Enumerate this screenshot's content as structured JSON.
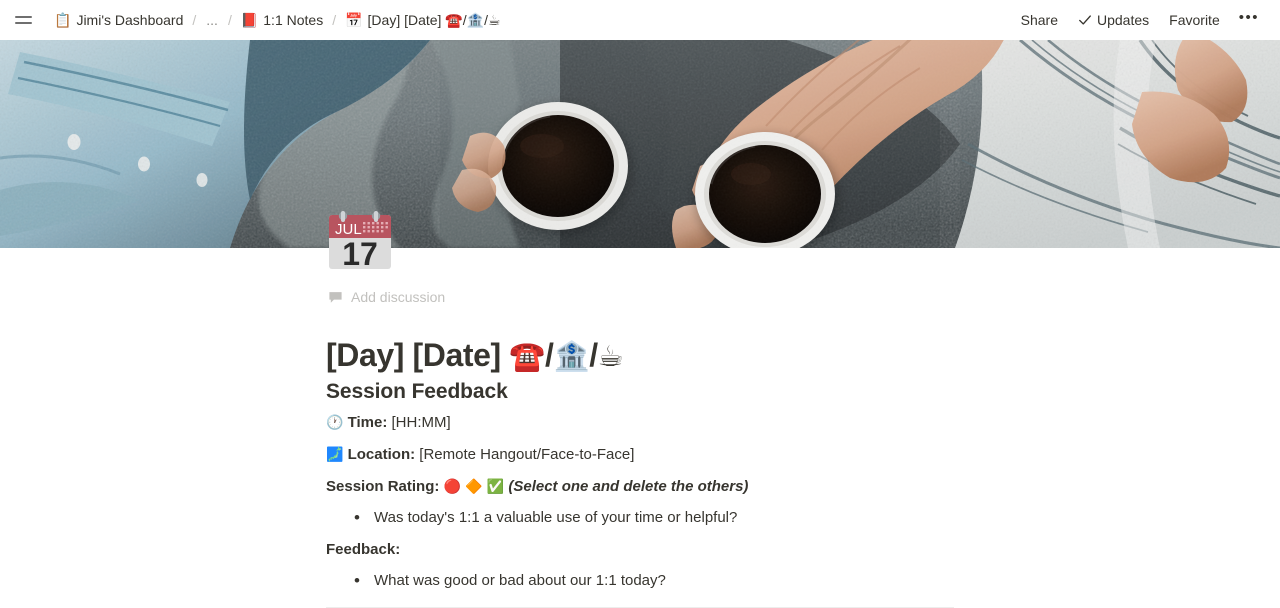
{
  "topbar": {
    "menu_icon": "hamburger-menu-icon",
    "breadcrumbs": [
      {
        "icon": "clipboard-emoji",
        "glyph": "📋",
        "label": "Jimi's Dashboard"
      },
      {
        "icon": "ellipsis",
        "glyph": "",
        "label": "..."
      },
      {
        "icon": "closed-book-emoji",
        "glyph": "📕",
        "label": "1:1 Notes"
      },
      {
        "icon": "calendar-emoji",
        "glyph": "📅",
        "label": "[Day] [Date] ☎️/🏦/☕"
      }
    ],
    "separator": "/",
    "actions": {
      "share": "Share",
      "updates": "Updates",
      "updates_icon": "checkmark-icon",
      "favorite": "Favorite",
      "more": "•••",
      "more_icon": "more-options-icon"
    }
  },
  "cover": {
    "alt": "Two people holding paper cups of black coffee, overhead view on a grey textured surface",
    "icon_emoji": "calendar-emoji",
    "icon_month": "JUL",
    "icon_day": "17"
  },
  "discussion": {
    "icon": "comment-icon",
    "label": "Add discussion"
  },
  "page": {
    "title_text": "[Day] [Date] ",
    "title_emoji_1": "☎️",
    "title_emoji_2": "🏦",
    "title_emoji_3": "☕",
    "title_slash": "/"
  },
  "body": {
    "section_heading": "Session Feedback",
    "time": {
      "icon": "clock-emoji",
      "glyph": "🕐",
      "label": "Time:",
      "value": "[HH:MM]"
    },
    "location": {
      "icon": "map-emoji",
      "glyph": "🗾",
      "label": "Location:",
      "value": "[Remote Hangout/Face-to-Face]"
    },
    "rating": {
      "label": "Session Rating:",
      "options": [
        "🔴",
        "🔶",
        "✅"
      ],
      "hint": "(Select one and delete the others)"
    },
    "rating_bullets": [
      "Was today's 1:1 a valuable use of your time or helpful?"
    ],
    "feedback": {
      "label": "Feedback:",
      "bullets": [
        "What was good or bad about our 1:1 today?"
      ]
    }
  },
  "colors": {
    "text": "#37352f",
    "muted": "#c2c1be",
    "divider": "#ededec",
    "calendar_red": "#b8545f"
  }
}
